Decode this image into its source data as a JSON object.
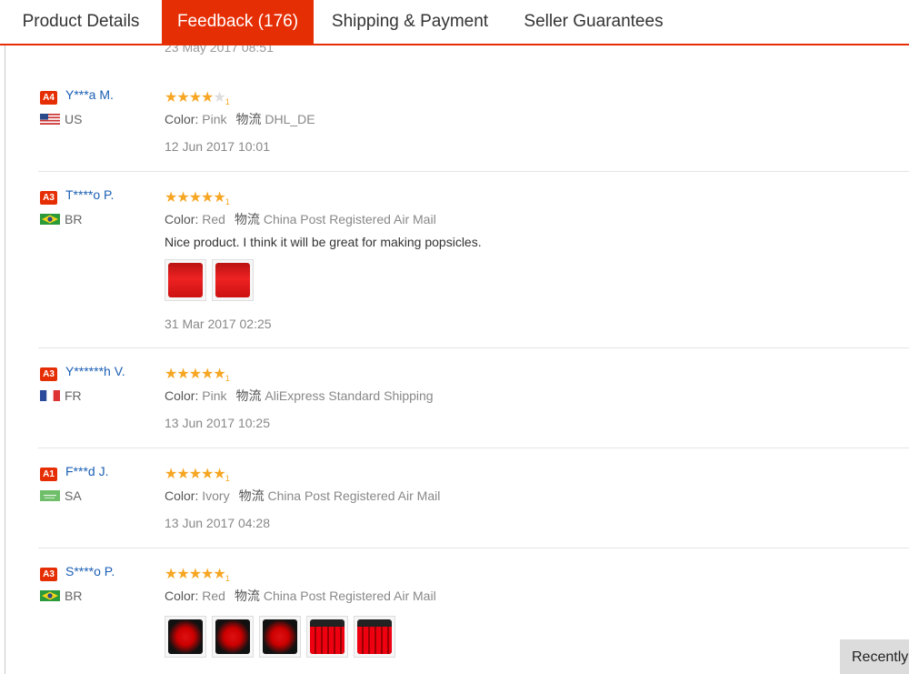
{
  "tabs": [
    {
      "label": "Product Details",
      "active": false
    },
    {
      "label": "Feedback (176)",
      "active": true
    },
    {
      "label": "Shipping & Payment",
      "active": false
    },
    {
      "label": "Seller Guarantees",
      "active": false
    }
  ],
  "previous_review_date": "23 May 2017 08:51",
  "labels": {
    "color": "Color:",
    "logistics": "物流"
  },
  "reviews": [
    {
      "level": "A4",
      "name": "Y***a M.",
      "country": "US",
      "rating": 4,
      "star_count_label": "1",
      "color": "Pink",
      "shipping": "DHL_DE",
      "text": "",
      "photos": 0,
      "date": "12 Jun 2017 10:01"
    },
    {
      "level": "A3",
      "name": "T****o P.",
      "country": "BR",
      "rating": 5,
      "star_count_label": "1",
      "color": "Red",
      "shipping": "China Post Registered Air Mail",
      "text": "Nice product. I think it will be great for making popsicles.",
      "photos": 2,
      "date": "31 Mar 2017 02:25"
    },
    {
      "level": "A3",
      "name": "Y******h V.",
      "country": "FR",
      "rating": 5,
      "star_count_label": "1",
      "color": "Pink",
      "shipping": "AliExpress Standard Shipping",
      "text": "",
      "photos": 0,
      "date": "13 Jun 2017 10:25"
    },
    {
      "level": "A1",
      "name": "F***d J.",
      "country": "SA",
      "rating": 5,
      "star_count_label": "1",
      "color": "Ivory",
      "shipping": "China Post Registered Air Mail",
      "text": "",
      "photos": 0,
      "date": "13 Jun 2017 04:28"
    },
    {
      "level": "A3",
      "name": "S****o P.",
      "country": "BR",
      "rating": 5,
      "star_count_label": "1",
      "color": "Red",
      "shipping": "China Post Registered Air Mail",
      "text": "",
      "photos": 5,
      "date": ""
    }
  ],
  "recently_viewed": "Recently",
  "colors": {
    "accent": "#e62e04",
    "star": "#f6a623",
    "link": "#1a5fb4"
  }
}
